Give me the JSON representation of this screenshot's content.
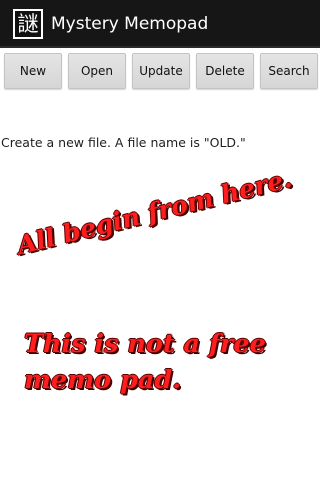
{
  "app": {
    "icon_glyph": "謎",
    "title": "Mystery Memopad"
  },
  "toolbar": {
    "buttons": [
      {
        "label": "New"
      },
      {
        "label": "Open"
      },
      {
        "label": "Update"
      },
      {
        "label": "Delete"
      },
      {
        "label": "Search"
      }
    ]
  },
  "content": {
    "message": "Create a new file. A file name is \"OLD.\"",
    "slogan_1": "All begin from here.",
    "slogan_2_line_1": "This is not a free",
    "slogan_2_line_2": "memo pad."
  },
  "colors": {
    "action_bar": "#161616",
    "slogan_fill": "#ff1e1e",
    "slogan_outline": "#5a0000"
  }
}
